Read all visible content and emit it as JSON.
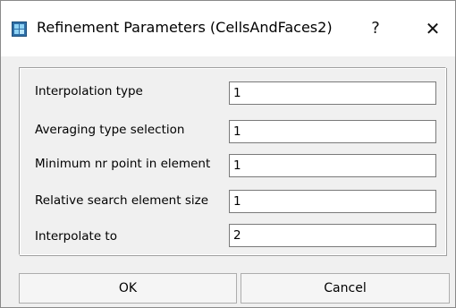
{
  "window": {
    "title": "Refinement Parameters (CellsAndFaces2)",
    "help_glyph": "?",
    "close_glyph": "✕"
  },
  "fields": [
    {
      "label": "Interpolation type",
      "value": "1"
    },
    {
      "label": "Averaging type selection",
      "value": "1"
    },
    {
      "label": "Minimum nr point in element",
      "value": "1"
    },
    {
      "label": "Relative search element size",
      "value": "1"
    },
    {
      "label": "Interpolate to",
      "value": "2"
    }
  ],
  "buttons": {
    "ok_label": "OK",
    "cancel_label": "Cancel"
  },
  "colors": {
    "dialog_background": "#f0f0f0",
    "titlebar_background": "#ffffff",
    "icon_accent": "#2e6ea6"
  },
  "icons": {
    "app": "app-icon",
    "help": "help-icon",
    "close": "close-icon"
  }
}
